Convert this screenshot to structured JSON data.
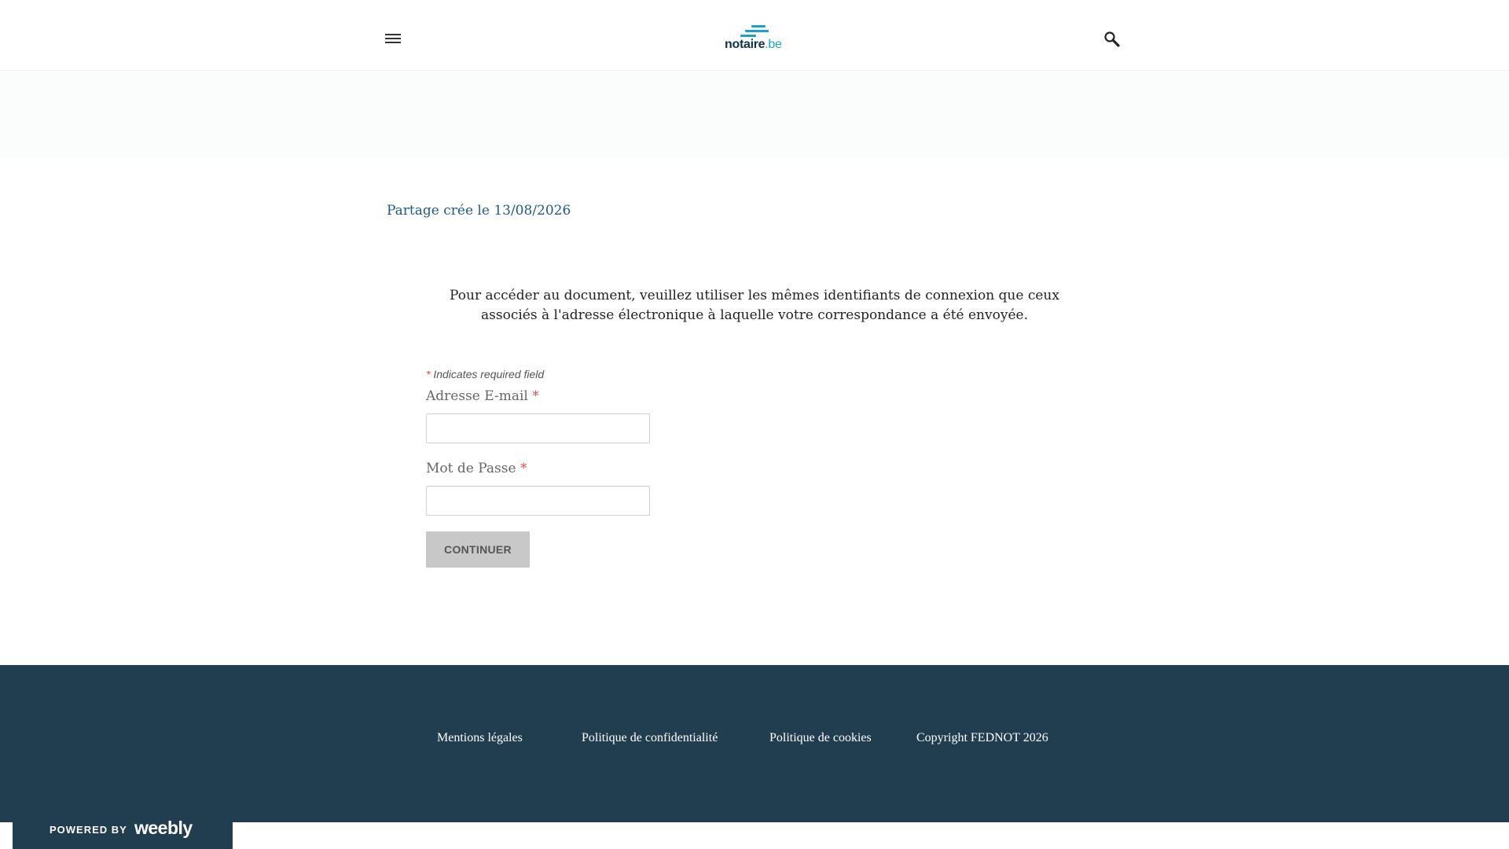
{
  "header": {
    "menu_icon": "hamburger-menu-icon",
    "logo_name": "notaire",
    "logo_tld": ".be",
    "logo_color": "#1aa3c7",
    "search_icon": "search-icon"
  },
  "main": {
    "share_date_text": "Partage crée le 13/08/2026",
    "intro_text": "Pour accéder au document, veuillez utiliser les mêmes identifiants de connexion que ceux associés à l'adresse électronique à laquelle votre correspondance a été envoyée."
  },
  "form": {
    "required_marker": "*",
    "required_note": "Indicates required field",
    "email_label": "Adresse E-mail",
    "email_value": "",
    "password_label": "Mot de Passe",
    "password_value": "",
    "submit_label": "CONTINUER"
  },
  "footer": {
    "links": [
      "Mentions légales",
      "Politique de confidentialité",
      "Politique de cookies"
    ],
    "copyright": "Copyright FEDNOT 2026",
    "background": "#213e51"
  },
  "badge": {
    "powered_by": "POWERED BY",
    "brand": "weebly"
  }
}
